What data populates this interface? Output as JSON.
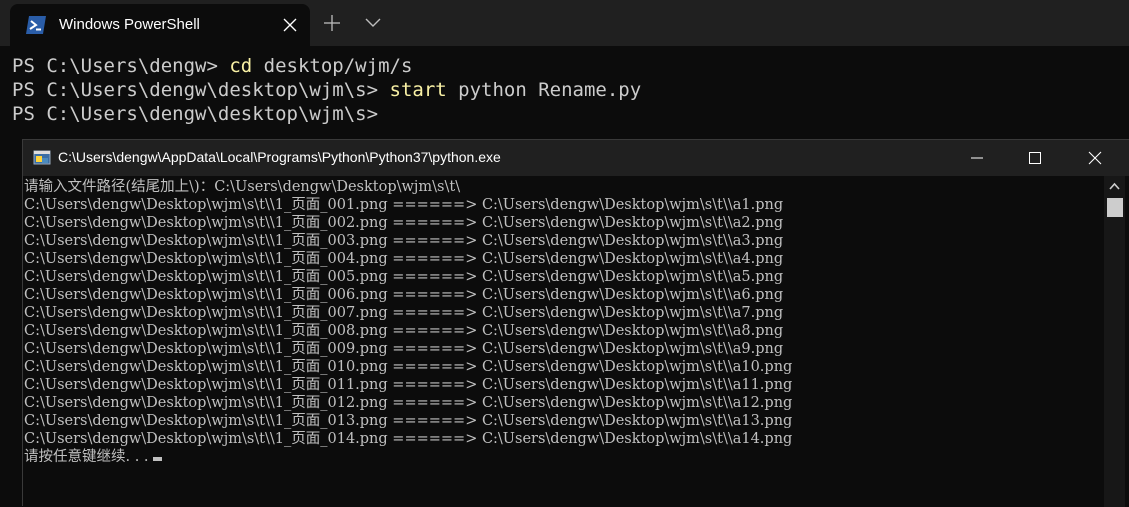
{
  "terminal": {
    "tab_title": "Windows PowerShell",
    "icons": {
      "tab": "powershell-icon",
      "close": "close-icon",
      "new_tab": "plus-icon",
      "dropdown": "chevron-down-icon"
    },
    "colors": {
      "background": "#0c0c0c",
      "tabbar": "#202020",
      "text": "#cccccc",
      "command": "#f9f1a5"
    }
  },
  "ps_lines": [
    {
      "prompt": "PS C:\\Users\\dengw> ",
      "command": "cd",
      "args": " desktop/wjm/s"
    },
    {
      "prompt": "PS C:\\Users\\dengw\\desktop\\wjm\\s> ",
      "command": "start",
      "args": " python Rename.py"
    },
    {
      "prompt": "PS C:\\Users\\dengw\\desktop\\wjm\\s>",
      "command": "",
      "args": ""
    }
  ],
  "console": {
    "title": "C:\\Users\\dengw\\AppData\\Local\\Programs\\Python\\Python37\\python.exe",
    "icons": {
      "app": "python-icon",
      "minimize": "minimize-icon",
      "maximize": "maximize-icon",
      "close": "close-icon"
    },
    "lines": [
      "请输入文件路径(结尾加上\\)：C:\\Users\\dengw\\Desktop\\wjm\\s\\t\\",
      "C:\\Users\\dengw\\Desktop\\wjm\\s\\t\\\\1_页面_001.png ======> C:\\Users\\dengw\\Desktop\\wjm\\s\\t\\\\a1.png",
      "C:\\Users\\dengw\\Desktop\\wjm\\s\\t\\\\1_页面_002.png ======> C:\\Users\\dengw\\Desktop\\wjm\\s\\t\\\\a2.png",
      "C:\\Users\\dengw\\Desktop\\wjm\\s\\t\\\\1_页面_003.png ======> C:\\Users\\dengw\\Desktop\\wjm\\s\\t\\\\a3.png",
      "C:\\Users\\dengw\\Desktop\\wjm\\s\\t\\\\1_页面_004.png ======> C:\\Users\\dengw\\Desktop\\wjm\\s\\t\\\\a4.png",
      "C:\\Users\\dengw\\Desktop\\wjm\\s\\t\\\\1_页面_005.png ======> C:\\Users\\dengw\\Desktop\\wjm\\s\\t\\\\a5.png",
      "C:\\Users\\dengw\\Desktop\\wjm\\s\\t\\\\1_页面_006.png ======> C:\\Users\\dengw\\Desktop\\wjm\\s\\t\\\\a6.png",
      "C:\\Users\\dengw\\Desktop\\wjm\\s\\t\\\\1_页面_007.png ======> C:\\Users\\dengw\\Desktop\\wjm\\s\\t\\\\a7.png",
      "C:\\Users\\dengw\\Desktop\\wjm\\s\\t\\\\1_页面_008.png ======> C:\\Users\\dengw\\Desktop\\wjm\\s\\t\\\\a8.png",
      "C:\\Users\\dengw\\Desktop\\wjm\\s\\t\\\\1_页面_009.png ======> C:\\Users\\dengw\\Desktop\\wjm\\s\\t\\\\a9.png",
      "C:\\Users\\dengw\\Desktop\\wjm\\s\\t\\\\1_页面_010.png ======> C:\\Users\\dengw\\Desktop\\wjm\\s\\t\\\\a10.png",
      "C:\\Users\\dengw\\Desktop\\wjm\\s\\t\\\\1_页面_011.png ======> C:\\Users\\dengw\\Desktop\\wjm\\s\\t\\\\a11.png",
      "C:\\Users\\dengw\\Desktop\\wjm\\s\\t\\\\1_页面_012.png ======> C:\\Users\\dengw\\Desktop\\wjm\\s\\t\\\\a12.png",
      "C:\\Users\\dengw\\Desktop\\wjm\\s\\t\\\\1_页面_013.png ======> C:\\Users\\dengw\\Desktop\\wjm\\s\\t\\\\a13.png",
      "C:\\Users\\dengw\\Desktop\\wjm\\s\\t\\\\1_页面_014.png ======> C:\\Users\\dengw\\Desktop\\wjm\\s\\t\\\\a14.png"
    ],
    "pause_prompt": "请按任意键继续. . .",
    "scroll_position": 0,
    "colors": {
      "background": "#0c0c0c",
      "text": "#c0c0c0",
      "titlebar": "#202020"
    }
  }
}
